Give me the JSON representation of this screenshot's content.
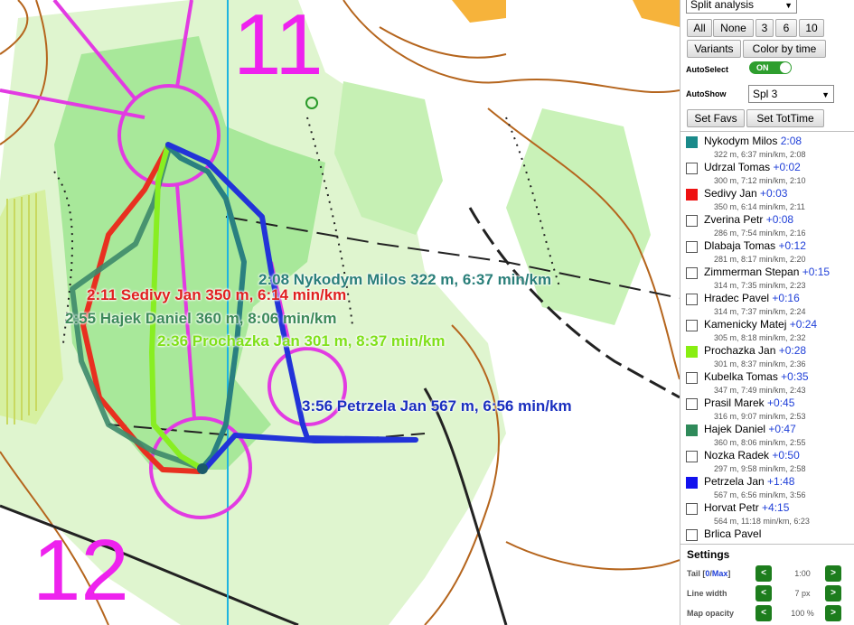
{
  "map": {
    "control_numbers": [
      "11",
      "12"
    ],
    "route_labels": [
      {
        "text": "2:08 Nykodym Milos 322 m, 6:37 min/km",
        "color": "#2a7f7a"
      },
      {
        "text": "2:11 Sedivy Jan 350 m, 6:14 min/km",
        "color": "#e02020"
      },
      {
        "text": "2:55 Hajek Daniel 360 m, 8:06 min/km",
        "color": "#3c8a5a"
      },
      {
        "text": "2:36 Prochazka Jan 301 m, 8:37 min/km",
        "color": "#7fe01a"
      },
      {
        "text": "3:56 Petrzela Jan 567 m, 6:56 min/km",
        "color": "#1a2fbf"
      }
    ]
  },
  "panel": {
    "analysis_select": "Split analysis",
    "buttons": {
      "all": "All",
      "none": "None",
      "three": "3",
      "six": "6",
      "ten": "10",
      "variants": "Variants",
      "color_by_time": "Color by time",
      "set_favs": "Set Favs",
      "set_tot_time": "Set TotTime"
    },
    "autoselect_label": "AutoSelect",
    "autoselect_state": "ON",
    "autoshow_label": "AutoShow",
    "autoshow_select": "Spl 3",
    "runners": [
      {
        "name": "Nykodym Milos",
        "time": "2:08",
        "detail": "322 m, 6:37 min/km, 2:08",
        "color": "#1a8a8a"
      },
      {
        "name": "Udrzal Tomas",
        "time": "+0:02",
        "detail": "300 m, 7:12 min/km, 2:10",
        "color": ""
      },
      {
        "name": "Sedivy Jan",
        "time": "+0:03",
        "detail": "350 m, 6:14 min/km, 2:11",
        "color": "#ee1111"
      },
      {
        "name": "Zverina Petr",
        "time": "+0:08",
        "detail": "286 m, 7:54 min/km, 2:16",
        "color": ""
      },
      {
        "name": "Dlabaja Tomas",
        "time": "+0:12",
        "detail": "281 m, 8:17 min/km, 2:20",
        "color": ""
      },
      {
        "name": "Zimmerman Stepan",
        "time": "+0:15",
        "detail": "314 m, 7:35 min/km, 2:23",
        "color": ""
      },
      {
        "name": "Hradec Pavel",
        "time": "+0:16",
        "detail": "314 m, 7:37 min/km, 2:24",
        "color": ""
      },
      {
        "name": "Kamenicky Matej",
        "time": "+0:24",
        "detail": "305 m, 8:18 min/km, 2:32",
        "color": ""
      },
      {
        "name": "Prochazka Jan",
        "time": "+0:28",
        "detail": "301 m, 8:37 min/km, 2:36",
        "color": "#88ee11"
      },
      {
        "name": "Kubelka Tomas",
        "time": "+0:35",
        "detail": "347 m, 7:49 min/km, 2:43",
        "color": ""
      },
      {
        "name": "Prasil Marek",
        "time": "+0:45",
        "detail": "316 m, 9:07 min/km, 2:53",
        "color": ""
      },
      {
        "name": "Hajek Daniel",
        "time": "+0:47",
        "detail": "360 m, 8:06 min/km, 2:55",
        "color": "#2f8a5a"
      },
      {
        "name": "Nozka Radek",
        "time": "+0:50",
        "detail": "297 m, 9:58 min/km, 2:58",
        "color": ""
      },
      {
        "name": "Petrzela Jan",
        "time": "+1:48",
        "detail": "567 m, 6:56 min/km, 3:56",
        "color": "#1111ee"
      },
      {
        "name": "Horvat Petr",
        "time": "+4:15",
        "detail": "564 m, 11:18 min/km, 6:23",
        "color": ""
      },
      {
        "name": "Brlica Pavel",
        "time": "",
        "detail": "",
        "color": ""
      }
    ],
    "settings": {
      "title": "Settings",
      "tail_label": "Tail [",
      "tail_link_zero": "0",
      "tail_sep": "/",
      "tail_link_max": "Max",
      "tail_end": "]",
      "tail_value": "1:00",
      "line_width_label": "Line width",
      "line_width_value": "7 px",
      "map_opacity_label": "Map opacity",
      "map_opacity_value": "100 %"
    }
  }
}
